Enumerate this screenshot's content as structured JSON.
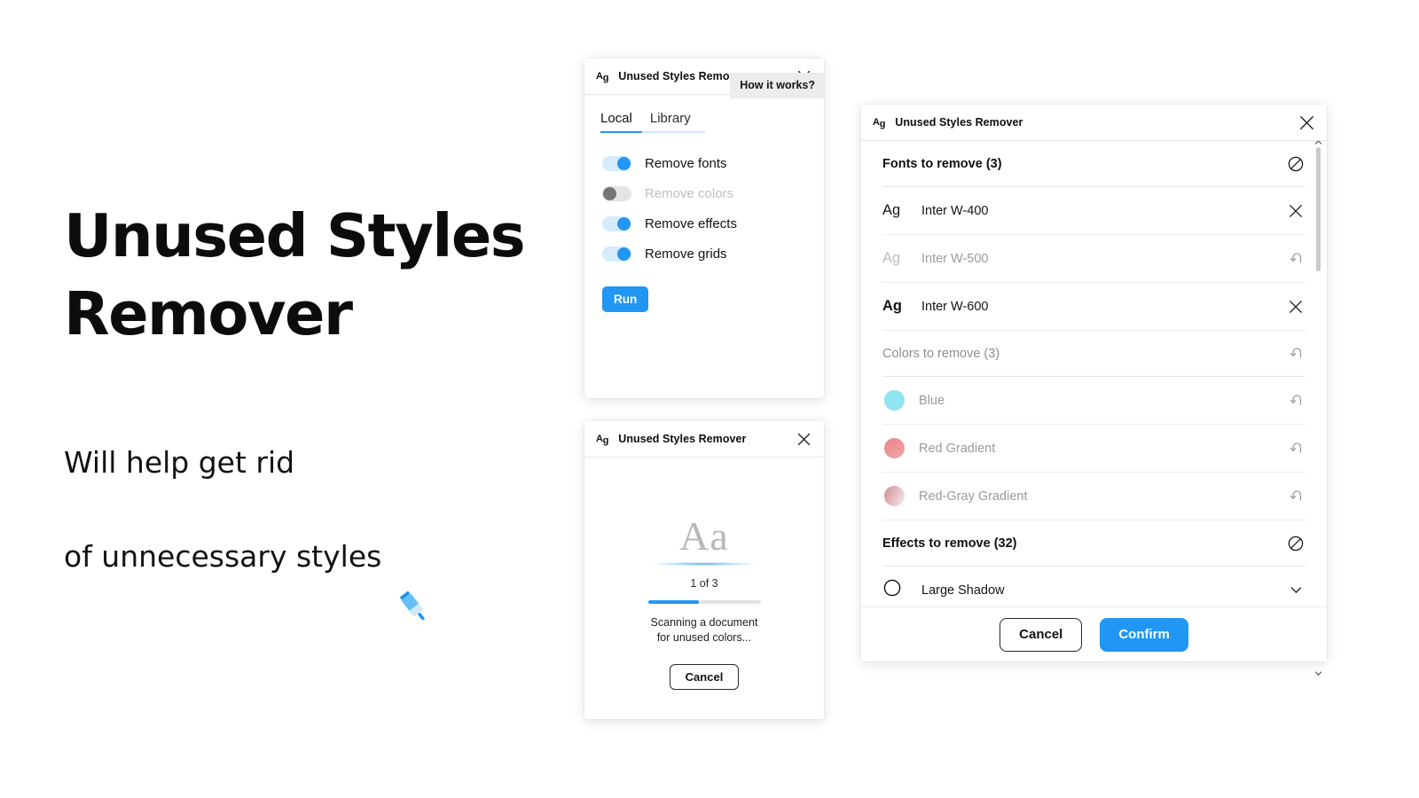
{
  "hero": {
    "title": "Unused Styles\nRemover",
    "subtitle_line1": "Will help get rid",
    "subtitle_line2": "of unnecessary styles",
    "brush_icon": "paintbrush-icon"
  },
  "brand": {
    "logo_text": "Ag",
    "accent_color": "#2196f3",
    "disabled_color": "#767676"
  },
  "options_panel": {
    "logo": "Ag",
    "title": "Unused Styles Remover",
    "close_icon": "close-icon",
    "tooltip": "How it works?",
    "tabs": [
      {
        "label": "Local",
        "active": true
      },
      {
        "label": "Library",
        "active": false
      }
    ],
    "switches": [
      {
        "label": "Remove fonts",
        "on": true,
        "disabled": false
      },
      {
        "label": "Remove colors",
        "on": false,
        "disabled": true
      },
      {
        "label": "Remove effects",
        "on": true,
        "disabled": false
      },
      {
        "label": "Remove grids",
        "on": true,
        "disabled": false
      }
    ],
    "run_label": "Run"
  },
  "scan_panel": {
    "logo": "Ag",
    "title": "Unused Styles Remover",
    "close_icon": "close-icon",
    "preview_glyph": "Aa",
    "step_counter": "1 of 3",
    "progress_percent": 45,
    "status_text": "Scanning a document\nfor unused colors...",
    "cancel_label": "Cancel"
  },
  "review_panel": {
    "logo": "Ag",
    "title": "Unused Styles Remover",
    "close_icon": "close-icon",
    "sections": [
      {
        "heading": "Fonts to remove (3)",
        "heading_dim": false,
        "heading_action_icon": "prohibition-icon",
        "rows": [
          {
            "type": "font",
            "sample": "Ag",
            "weight": "w400",
            "label": "Inter W-400",
            "dim": false,
            "action_icon": "close-icon"
          },
          {
            "type": "font",
            "sample": "Ag",
            "weight": "w500",
            "label": "Inter W-500",
            "dim": true,
            "action_icon": "undo-icon"
          },
          {
            "type": "font",
            "sample": "Ag",
            "weight": "w600",
            "label": "Inter W-600",
            "dim": false,
            "action_icon": "close-icon"
          }
        ]
      },
      {
        "heading": "Colors to remove (3)",
        "heading_dim": true,
        "heading_action_icon": "undo-icon",
        "rows": [
          {
            "type": "color",
            "label": "Blue",
            "swatch": "#8ee4f2",
            "dim": true,
            "action_icon": "undo-icon"
          },
          {
            "type": "color",
            "label": "Red Gradient",
            "swatch": "#e8868c",
            "dim": true,
            "action_icon": "undo-icon"
          },
          {
            "type": "color",
            "label": "Red-Gray Gradient",
            "swatch": "#cf8b90",
            "dim": true,
            "action_icon": "undo-icon"
          }
        ]
      },
      {
        "heading": "Effects to remove (32)",
        "heading_dim": false,
        "heading_action_icon": "prohibition-icon",
        "rows": [
          {
            "type": "effect",
            "label": "Large Shadow",
            "dim": false,
            "action_icon": "chevron-down-icon"
          }
        ]
      }
    ],
    "cancel_label": "Cancel",
    "confirm_label": "Confirm"
  }
}
